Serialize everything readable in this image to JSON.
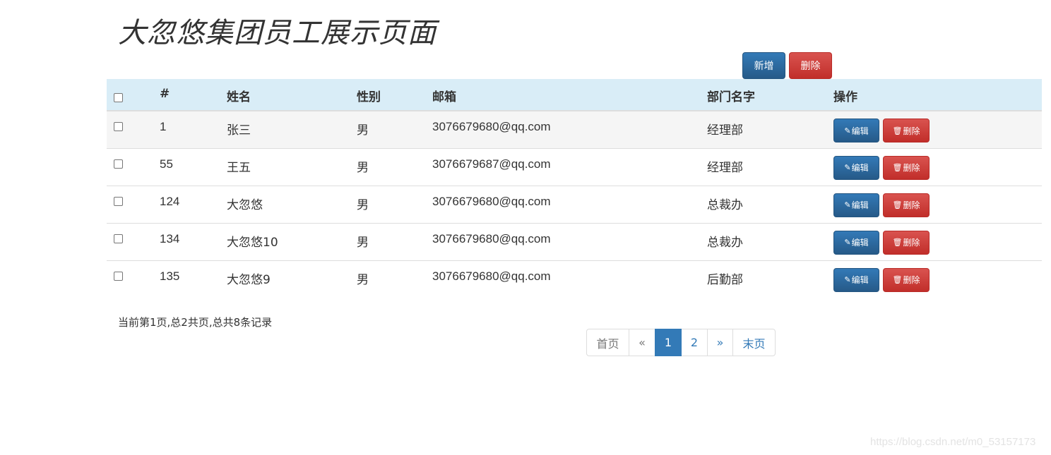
{
  "header": {
    "title": "大忽悠集团员工展示页面"
  },
  "toolbar": {
    "add_label": "新增",
    "delete_label": "删除"
  },
  "table": {
    "columns": [
      "#",
      "姓名",
      "性别",
      "邮箱",
      "部门名字",
      "操作"
    ],
    "rows": [
      {
        "id": "1",
        "name": "张三",
        "gender": "男",
        "email": "3076679680@qq.com",
        "dept": "经理部"
      },
      {
        "id": "55",
        "name": "王五",
        "gender": "男",
        "email": "3076679687@qq.com",
        "dept": "经理部"
      },
      {
        "id": "124",
        "name": "大忽悠",
        "gender": "男",
        "email": "3076679680@qq.com",
        "dept": "总裁办"
      },
      {
        "id": "134",
        "name": "大忽悠10",
        "gender": "男",
        "email": "3076679680@qq.com",
        "dept": "总裁办"
      },
      {
        "id": "135",
        "name": "大忽悠9",
        "gender": "男",
        "email": "3076679680@qq.com",
        "dept": "后勤部"
      }
    ],
    "row_actions": {
      "edit_label": "编辑",
      "delete_label": "删除"
    }
  },
  "footer": {
    "page_info": "当前第1页,总2共页,总共8条记录"
  },
  "pagination": {
    "first": "首页",
    "prev": "«",
    "pages": [
      "1",
      "2"
    ],
    "active_page": "1",
    "next": "»",
    "last": "末页"
  },
  "watermark": "https://blog.csdn.net/m0_53157173",
  "colors": {
    "primary": "#337ab7",
    "danger": "#d9534f",
    "header_bg": "#d9edf7",
    "stripe": "#f5f5f5"
  },
  "icons": {
    "edit": "pencil-icon",
    "delete": "trash-icon"
  }
}
